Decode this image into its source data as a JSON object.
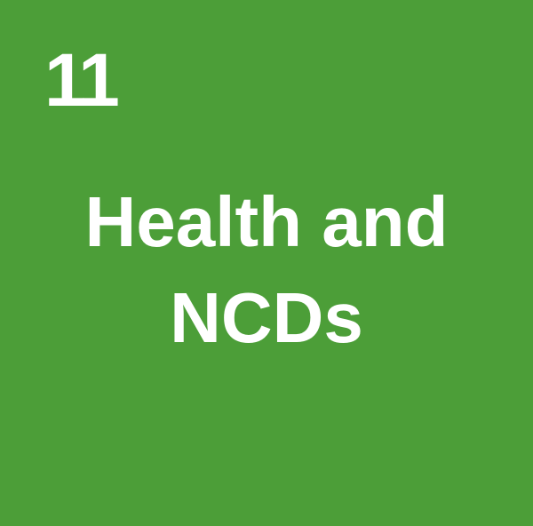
{
  "tile": {
    "number": "11",
    "title_lines": [
      "Health and",
      "NCDs"
    ],
    "background_color": "#4c9e38",
    "text_color": "#ffffff"
  }
}
